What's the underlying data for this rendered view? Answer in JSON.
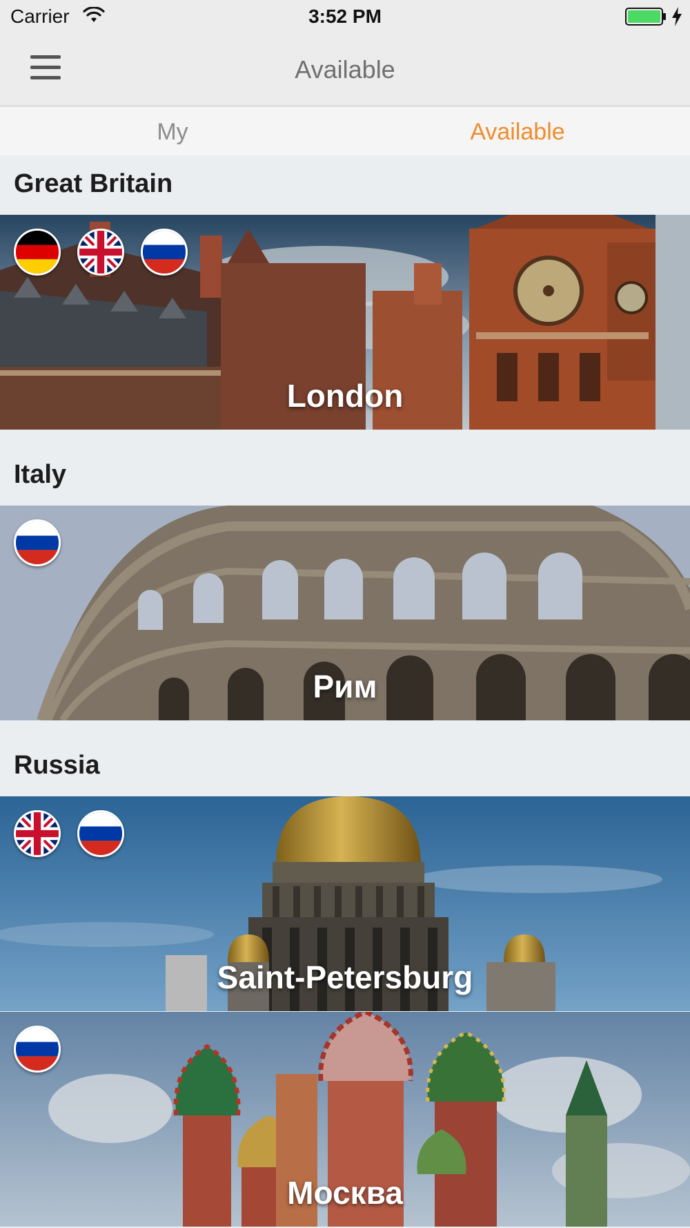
{
  "status_bar": {
    "carrier": "Carrier",
    "time": "3:52 PM",
    "battery_color": "#4cd964"
  },
  "nav": {
    "title": "Available",
    "menu_icon": "hamburger-menu-icon"
  },
  "tabs": [
    {
      "label": "My",
      "active": false
    },
    {
      "label": "Available",
      "active": true
    }
  ],
  "accent_color": "#f08c2c",
  "sections": [
    {
      "country": "Great Britain",
      "cities": [
        {
          "name": "London",
          "flags": [
            "german-flag-icon",
            "uk-flag-icon",
            "russian-flag-icon"
          ]
        }
      ]
    },
    {
      "country": "Italy",
      "cities": [
        {
          "name": "Рим",
          "flags": [
            "russian-flag-icon"
          ]
        }
      ]
    },
    {
      "country": "Russia",
      "cities": [
        {
          "name": "Saint-Petersburg",
          "flags": [
            "uk-flag-icon",
            "russian-flag-icon"
          ]
        },
        {
          "name": "Москва",
          "flags": [
            "russian-flag-icon"
          ]
        }
      ]
    }
  ]
}
